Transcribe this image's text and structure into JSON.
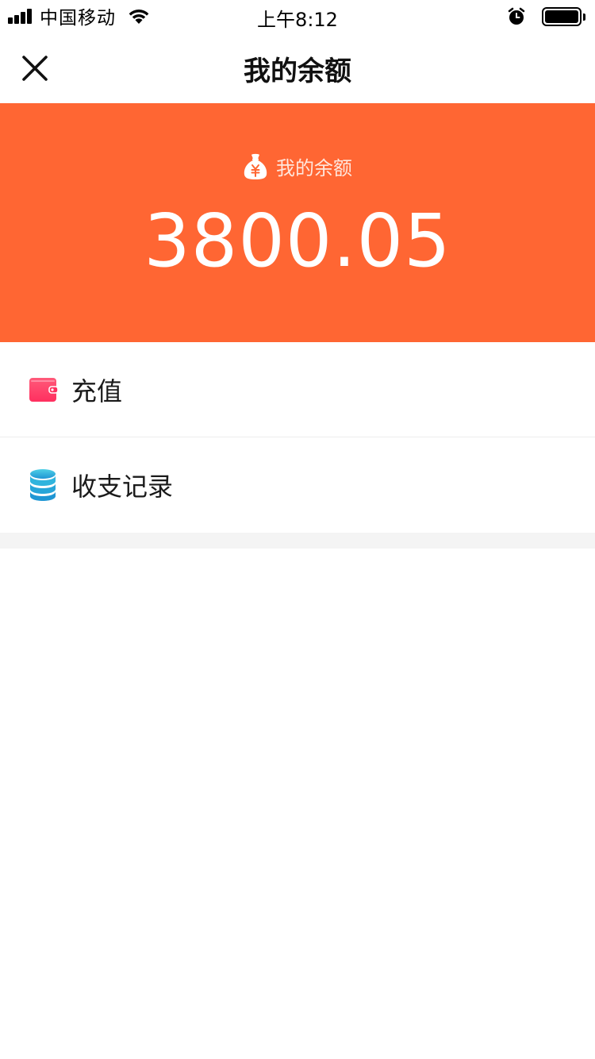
{
  "status_bar": {
    "carrier": "中国移动",
    "time": "上午8:12"
  },
  "nav": {
    "title": "我的余额",
    "close_icon": "close-icon"
  },
  "banner": {
    "label": "我的余额",
    "icon": "money-bag-icon",
    "amount": "3800.05",
    "background_color": "#ff6633"
  },
  "menu": {
    "items": [
      {
        "label": "充值",
        "icon": "wallet-icon"
      },
      {
        "label": "收支记录",
        "icon": "coin-stack-icon"
      }
    ]
  }
}
